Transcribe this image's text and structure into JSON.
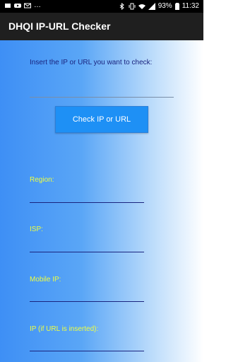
{
  "status_bar": {
    "time": "11:32",
    "battery": "93%",
    "left_icons": [
      "notification-icon",
      "youtube-icon",
      "email-icon",
      "more-icon"
    ],
    "right_icons": [
      "bluetooth-icon",
      "vibrate-icon",
      "wifi-icon",
      "signal-icon",
      "battery-icon"
    ]
  },
  "app_bar": {
    "title": "DHQI IP-URL Checker"
  },
  "form": {
    "prompt": "Insert the IP or URL you want to check:",
    "input_value": "",
    "button_label": "Check IP or URL"
  },
  "fields": {
    "region": "Region:",
    "isp": "ISP:",
    "mobile_ip": "Mobile IP:",
    "ip_if_url": "IP (if URL is inserted):"
  },
  "colors": {
    "label": "#eeff41",
    "button": "#1e90f5",
    "prompt": "#1a237e",
    "app_bar": "#1f1f1f"
  }
}
